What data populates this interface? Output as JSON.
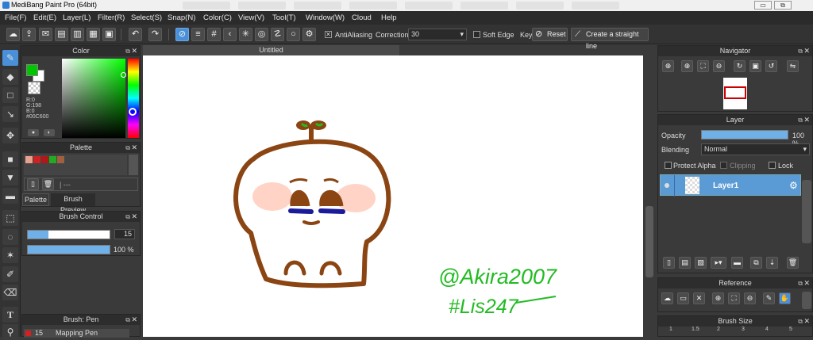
{
  "window": {
    "title": "MediBang Paint Pro (64bit)",
    "minimize": "▭",
    "restore": "⧉"
  },
  "menu": [
    "File(F)",
    "Edit(E)",
    "Layer(L)",
    "Filter(R)",
    "Select(S)",
    "Snap(N)",
    "Color(C)",
    "View(V)",
    "Tool(T)",
    "Window(W)",
    "Cloud",
    "Help"
  ],
  "toolbar": {
    "antialiasing_label": "AntiAliasing",
    "antialiasing_checked": "✕",
    "correction_label": "Correction",
    "correction_value": "30",
    "soft_edge_label": "Soft Edge",
    "key_label": "Key",
    "reset_label": "Reset",
    "straight_line_label": "Create a straight line"
  },
  "color_panel": {
    "title": "Color",
    "r": "R:0",
    "g": "G:198",
    "b": "B:0",
    "hex": "#00C600",
    "foreground_color": "#00c600"
  },
  "palette_panel": {
    "title": "Palette",
    "swatches": [
      "#e8a090",
      "#cc2222",
      "#b01818",
      "#22aa22",
      "#a06040"
    ],
    "footer_text": "| ---",
    "tabs": [
      "Palette",
      "Brush Preview"
    ]
  },
  "brush_control": {
    "title": "Brush Control",
    "size_value": "15",
    "opacity_value": "100 %",
    "size_fraction": 0.25,
    "opacity_fraction": 1.0
  },
  "brush_panel": {
    "title": "Brush: Pen",
    "size": "15",
    "name": "Mapping Pen"
  },
  "canvas": {
    "tab_title": "Untitled",
    "signature_line1": "@Akira2007",
    "signature_line2": "#Lis247"
  },
  "navigator": {
    "title": "Navigator"
  },
  "layer_panel": {
    "title": "Layer",
    "opacity_label": "Opacity",
    "opacity_value": "100 %",
    "opacity_fraction": 1.0,
    "blending_label": "Blending",
    "blending_value": "Normal",
    "protect_alpha": "Protect Alpha",
    "clipping": "Clipping",
    "lock": "Lock",
    "layers": [
      {
        "name": "Layer1"
      }
    ]
  },
  "reference_panel": {
    "title": "Reference"
  },
  "brush_size_panel": {
    "title": "Brush Size",
    "sizes": [
      "1",
      "1.5",
      "2",
      "3",
      "4",
      "5"
    ]
  }
}
